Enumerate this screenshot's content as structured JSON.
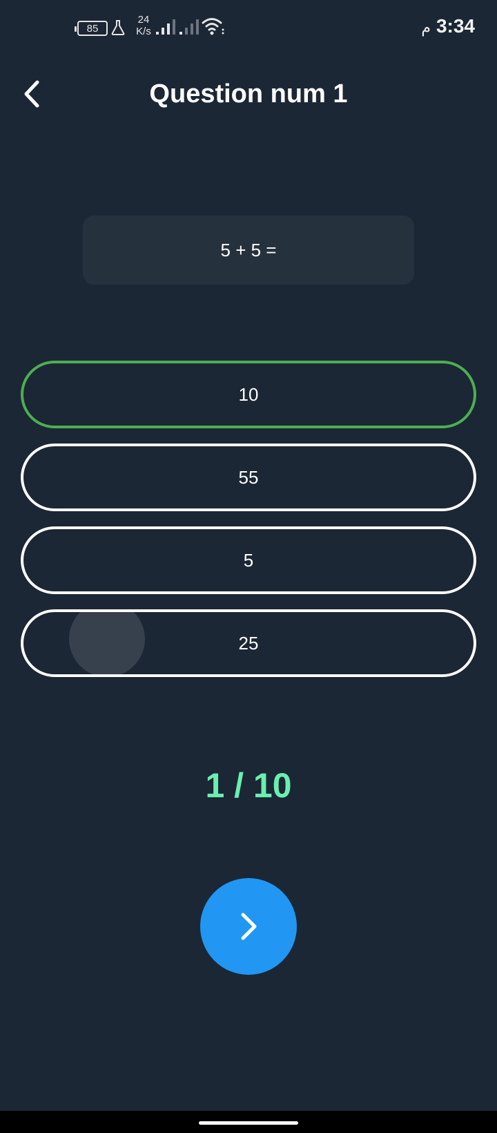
{
  "status_bar": {
    "battery_level": "85",
    "network_speed_value": "24",
    "network_speed_unit": "K/s",
    "time": "3:34",
    "ampm": "م",
    "icons": [
      "battery-icon",
      "flask-icon",
      "signal-icon",
      "signal-icon",
      "wifi-icon"
    ]
  },
  "header": {
    "title": "Question num 1",
    "back_icon": "chevron-left-icon"
  },
  "question": {
    "text": "5 + 5 ="
  },
  "answers": [
    {
      "label": "10",
      "state": "correct"
    },
    {
      "label": "55",
      "state": "default"
    },
    {
      "label": "5",
      "state": "default"
    },
    {
      "label": "25",
      "state": "pressed"
    }
  ],
  "progress": {
    "text": "1 / 10",
    "current": 1,
    "total": 10
  },
  "next_button": {
    "icon": "chevron-right-icon"
  },
  "colors": {
    "background": "#1b2735",
    "card": "#25313d",
    "correct_border": "#4caf50",
    "progress_text": "#69f0ae",
    "next_button": "#2196f3"
  }
}
